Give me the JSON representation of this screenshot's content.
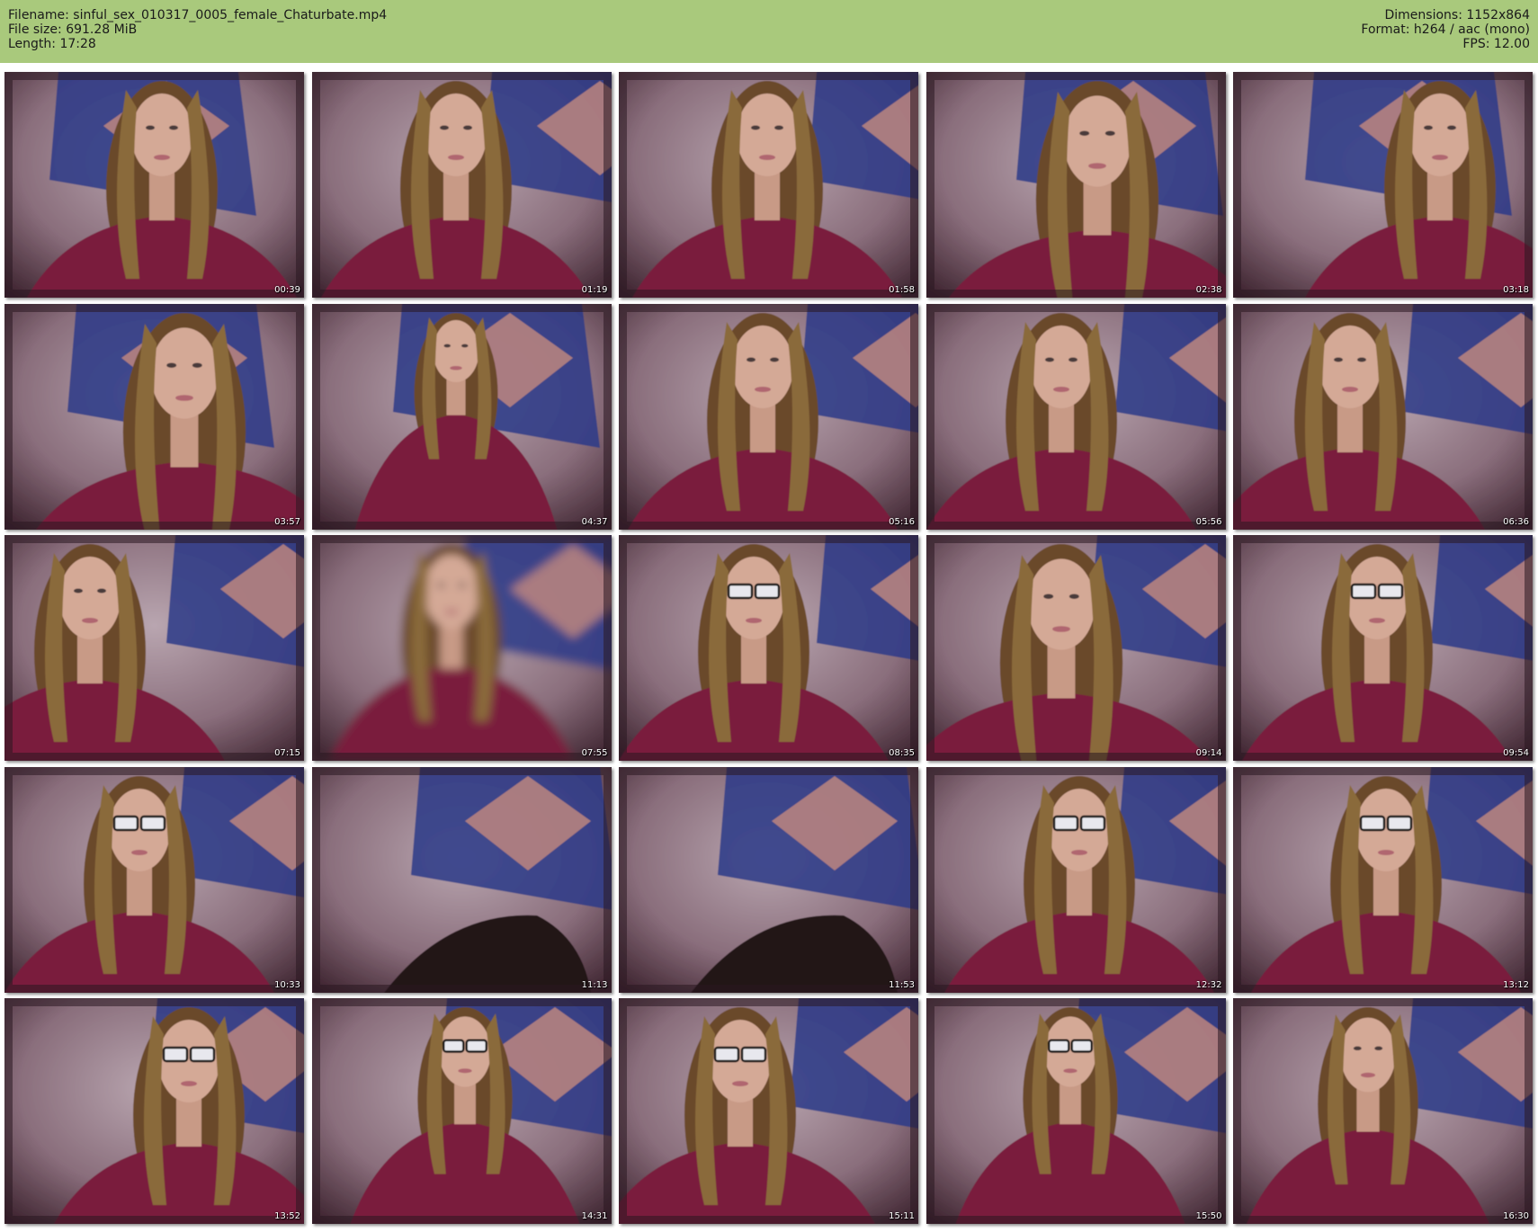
{
  "header": {
    "filename": "Filename: sinful_sex_010317_0005_female_Chaturbate.mp4",
    "filesize": "File size: 691.28 MiB",
    "length": "Length: 17:28",
    "dimensions": "Dimensions: 1152x864",
    "format": "Format: h264 / aac (mono)",
    "fps": "FPS: 12.00"
  },
  "colors": {
    "header_bg": "#a9c97c",
    "shirt": "#7a1e3c",
    "flag_blue": "#2a3a8c",
    "wall": "#9e8a94"
  },
  "thumbnails": [
    {
      "time": "00:39"
    },
    {
      "time": "01:19"
    },
    {
      "time": "01:58"
    },
    {
      "time": "02:38"
    },
    {
      "time": "03:18"
    },
    {
      "time": "03:57"
    },
    {
      "time": "04:37"
    },
    {
      "time": "05:16"
    },
    {
      "time": "05:56"
    },
    {
      "time": "06:36"
    },
    {
      "time": "07:15"
    },
    {
      "time": "07:55"
    },
    {
      "time": "08:35"
    },
    {
      "time": "09:14"
    },
    {
      "time": "09:54"
    },
    {
      "time": "10:33"
    },
    {
      "time": "11:13"
    },
    {
      "time": "11:53"
    },
    {
      "time": "12:32"
    },
    {
      "time": "13:12"
    },
    {
      "time": "13:52"
    },
    {
      "time": "14:31"
    },
    {
      "time": "15:11"
    },
    {
      "time": "15:50"
    },
    {
      "time": "16:30"
    }
  ]
}
